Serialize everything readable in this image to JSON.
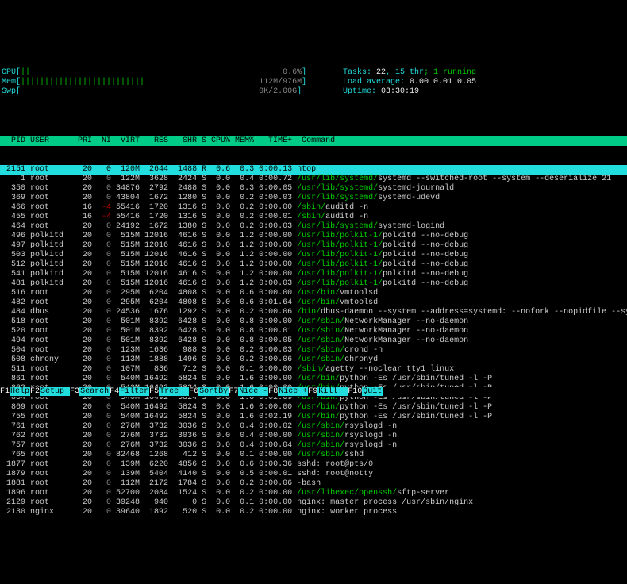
{
  "meters": {
    "cpu": {
      "label": "CPU",
      "bar": "||",
      "value": "0.6%"
    },
    "mem": {
      "label": "Mem",
      "bar": "||||||||||||||||||||||||||",
      "value": "112M/976M"
    },
    "swp": {
      "label": "Swp",
      "bar": "",
      "value": "0K/2.00G"
    }
  },
  "stats": {
    "tasks_label": "Tasks: ",
    "tasks": "22",
    "thr": ", 15 thr",
    "running": "; 1 running",
    "load_label": "Load average: ",
    "load": "0.00 0.01 0.05",
    "uptime_label": "Uptime: ",
    "uptime": "03:30:19"
  },
  "columns": "  PID USER      PRI  NI  VIRT   RES   SHR S CPU% MEM%   TIME+  Command",
  "rows": [
    {
      "sel": true,
      "pid": "2151",
      "user": "root",
      "pri": "20",
      "ni": "0",
      "virt": "120M",
      "res": "2644",
      "shr": "1488",
      "s": "R",
      "cpu": "0.6",
      "mem": "0.3",
      "time": "0:00.13",
      "cmd": "htop",
      "path": ""
    },
    {
      "pid": "1",
      "user": "root",
      "pri": "20",
      "ni": "0",
      "virt": "122M",
      "res": "3628",
      "shr": "2424",
      "s": "S",
      "cpu": "0.0",
      "mem": "0.4",
      "time": "0:00.72",
      "path": "/usr/lib/systemd/",
      "cmd": "systemd --switched-root --system --deserialize 21"
    },
    {
      "pid": "350",
      "user": "root",
      "pri": "20",
      "ni": "0",
      "virt": "34876",
      "res": "2792",
      "shr": "2488",
      "s": "S",
      "cpu": "0.0",
      "mem": "0.3",
      "time": "0:00.05",
      "path": "/usr/lib/systemd/",
      "cmd": "systemd-journald"
    },
    {
      "pid": "369",
      "user": "root",
      "pri": "20",
      "ni": "0",
      "virt": "43804",
      "res": "1672",
      "shr": "1280",
      "s": "S",
      "cpu": "0.0",
      "mem": "0.2",
      "time": "0:00.03",
      "path": "/usr/lib/systemd/",
      "cmd": "systemd-udevd"
    },
    {
      "pid": "466",
      "user": "root",
      "pri": "16",
      "ni": "-4",
      "virt": "55416",
      "res": "1720",
      "shr": "1316",
      "s": "S",
      "cpu": "0.0",
      "mem": "0.2",
      "time": "0:00.00",
      "path": "/sbin/",
      "cmd": "auditd -n"
    },
    {
      "pid": "455",
      "user": "root",
      "pri": "16",
      "ni": "-4",
      "virt": "55416",
      "res": "1720",
      "shr": "1316",
      "s": "S",
      "cpu": "0.0",
      "mem": "0.2",
      "time": "0:00.01",
      "path": "/sbin/",
      "cmd": "auditd -n"
    },
    {
      "pid": "464",
      "user": "root",
      "pri": "20",
      "ni": "0",
      "virt": "24192",
      "res": "1672",
      "shr": "1380",
      "s": "S",
      "cpu": "0.0",
      "mem": "0.2",
      "time": "0:00.03",
      "path": "/usr/lib/systemd/",
      "cmd": "systemd-logind"
    },
    {
      "pid": "496",
      "user": "polkitd",
      "pri": "20",
      "ni": "0",
      "virt": "515M",
      "res": "12016",
      "shr": "4616",
      "s": "S",
      "cpu": "0.0",
      "mem": "1.2",
      "time": "0:00.00",
      "path": "/usr/lib/polkit-1/",
      "cmd": "polkitd --no-debug"
    },
    {
      "pid": "497",
      "user": "polkitd",
      "pri": "20",
      "ni": "0",
      "virt": "515M",
      "res": "12016",
      "shr": "4616",
      "s": "S",
      "cpu": "0.0",
      "mem": "1.2",
      "time": "0:00.00",
      "path": "/usr/lib/polkit-1/",
      "cmd": "polkitd --no-debug"
    },
    {
      "pid": "503",
      "user": "polkitd",
      "pri": "20",
      "ni": "0",
      "virt": "515M",
      "res": "12016",
      "shr": "4616",
      "s": "S",
      "cpu": "0.0",
      "mem": "1.2",
      "time": "0:00.00",
      "path": "/usr/lib/polkit-1/",
      "cmd": "polkitd --no-debug"
    },
    {
      "pid": "512",
      "user": "polkitd",
      "pri": "20",
      "ni": "0",
      "virt": "515M",
      "res": "12016",
      "shr": "4616",
      "s": "S",
      "cpu": "0.0",
      "mem": "1.2",
      "time": "0:00.00",
      "path": "/usr/lib/polkit-1/",
      "cmd": "polkitd --no-debug"
    },
    {
      "pid": "541",
      "user": "polkitd",
      "pri": "20",
      "ni": "0",
      "virt": "515M",
      "res": "12016",
      "shr": "4616",
      "s": "S",
      "cpu": "0.0",
      "mem": "1.2",
      "time": "0:00.00",
      "path": "/usr/lib/polkit-1/",
      "cmd": "polkitd --no-debug"
    },
    {
      "pid": "481",
      "user": "polkitd",
      "pri": "20",
      "ni": "0",
      "virt": "515M",
      "res": "12016",
      "shr": "4616",
      "s": "S",
      "cpu": "0.0",
      "mem": "1.2",
      "time": "0:00.03",
      "path": "/usr/lib/polkit-1/",
      "cmd": "polkitd --no-debug"
    },
    {
      "pid": "516",
      "user": "root",
      "pri": "20",
      "ni": "0",
      "virt": "295M",
      "res": "6204",
      "shr": "4808",
      "s": "S",
      "cpu": "0.0",
      "mem": "0.6",
      "time": "0:00.00",
      "path": "/usr/bin/",
      "cmd": "vmtoolsd"
    },
    {
      "pid": "482",
      "user": "root",
      "pri": "20",
      "ni": "0",
      "virt": "295M",
      "res": "6204",
      "shr": "4808",
      "s": "S",
      "cpu": "0.0",
      "mem": "0.6",
      "time": "0:01.64",
      "path": "/usr/bin/",
      "cmd": "vmtoolsd"
    },
    {
      "pid": "484",
      "user": "dbus",
      "pri": "20",
      "ni": "0",
      "virt": "24536",
      "res": "1676",
      "shr": "1292",
      "s": "S",
      "cpu": "0.0",
      "mem": "0.2",
      "time": "0:00.06",
      "path": "/bin/",
      "cmd": "dbus-daemon --system --address=systemd: --nofork --nopidfile --systemd-activation"
    },
    {
      "pid": "518",
      "user": "root",
      "pri": "20",
      "ni": "0",
      "virt": "501M",
      "res": "8392",
      "shr": "6428",
      "s": "S",
      "cpu": "0.0",
      "mem": "0.8",
      "time": "0:00.00",
      "path": "/usr/sbin/",
      "cmd": "NetworkManager --no-daemon"
    },
    {
      "pid": "520",
      "user": "root",
      "pri": "20",
      "ni": "0",
      "virt": "501M",
      "res": "8392",
      "shr": "6428",
      "s": "S",
      "cpu": "0.0",
      "mem": "0.8",
      "time": "0:00.01",
      "path": "/usr/sbin/",
      "cmd": "NetworkManager --no-daemon"
    },
    {
      "pid": "494",
      "user": "root",
      "pri": "20",
      "ni": "0",
      "virt": "501M",
      "res": "8392",
      "shr": "6428",
      "s": "S",
      "cpu": "0.0",
      "mem": "0.8",
      "time": "0:00.05",
      "path": "/usr/sbin/",
      "cmd": "NetworkManager --no-daemon"
    },
    {
      "pid": "504",
      "user": "root",
      "pri": "20",
      "ni": "0",
      "virt": "123M",
      "res": "1636",
      "shr": "988",
      "s": "S",
      "cpu": "0.0",
      "mem": "0.2",
      "time": "0:00.03",
      "path": "/usr/sbin/",
      "cmd": "crond -n"
    },
    {
      "pid": "508",
      "user": "chrony",
      "pri": "20",
      "ni": "0",
      "virt": "113M",
      "res": "1888",
      "shr": "1496",
      "s": "S",
      "cpu": "0.0",
      "mem": "0.2",
      "time": "0:00.06",
      "path": "/usr/sbin/",
      "cmd": "chronyd"
    },
    {
      "pid": "511",
      "user": "root",
      "pri": "20",
      "ni": "0",
      "virt": "107M",
      "res": "836",
      "shr": "712",
      "s": "S",
      "cpu": "0.0",
      "mem": "0.1",
      "time": "0:00.00",
      "path": "/sbin/",
      "cmd": "agetty --noclear tty1 linux"
    },
    {
      "pid": "861",
      "user": "root",
      "pri": "20",
      "ni": "0",
      "virt": "540M",
      "res": "16492",
      "shr": "5824",
      "s": "S",
      "cpu": "0.0",
      "mem": "1.6",
      "time": "0:00.00",
      "path": "/usr/bin/",
      "cmd": "python -Es /usr/sbin/tuned -l -P"
    },
    {
      "pid": "862",
      "user": "root",
      "pri": "20",
      "ni": "0",
      "virt": "540M",
      "res": "16492",
      "shr": "5824",
      "s": "S",
      "cpu": "0.0",
      "mem": "1.6",
      "time": "0:00.00",
      "path": "/usr/bin/",
      "cmd": "python -Es /usr/sbin/tuned -l -P"
    },
    {
      "pid": "864",
      "user": "root",
      "pri": "20",
      "ni": "0",
      "virt": "540M",
      "res": "16492",
      "shr": "5824",
      "s": "S",
      "cpu": "0.0",
      "mem": "1.6",
      "time": "0:02.09",
      "path": "/usr/bin/",
      "cmd": "python -Es /usr/sbin/tuned -l -P"
    },
    {
      "pid": "869",
      "user": "root",
      "pri": "20",
      "ni": "0",
      "virt": "540M",
      "res": "16492",
      "shr": "5824",
      "s": "S",
      "cpu": "0.0",
      "mem": "1.6",
      "time": "0:00.00",
      "path": "/usr/bin/",
      "cmd": "python -Es /usr/sbin/tuned -l -P"
    },
    {
      "pid": "755",
      "user": "root",
      "pri": "20",
      "ni": "0",
      "virt": "540M",
      "res": "16492",
      "shr": "5824",
      "s": "S",
      "cpu": "0.0",
      "mem": "1.6",
      "time": "0:02.19",
      "path": "/usr/bin/",
      "cmd": "python -Es /usr/sbin/tuned -l -P"
    },
    {
      "pid": "761",
      "user": "root",
      "pri": "20",
      "ni": "0",
      "virt": "276M",
      "res": "3732",
      "shr": "3036",
      "s": "S",
      "cpu": "0.0",
      "mem": "0.4",
      "time": "0:00.02",
      "path": "/usr/sbin/",
      "cmd": "rsyslogd -n"
    },
    {
      "pid": "762",
      "user": "root",
      "pri": "20",
      "ni": "0",
      "virt": "276M",
      "res": "3732",
      "shr": "3036",
      "s": "S",
      "cpu": "0.0",
      "mem": "0.4",
      "time": "0:00.00",
      "path": "/usr/sbin/",
      "cmd": "rsyslogd -n"
    },
    {
      "pid": "757",
      "user": "root",
      "pri": "20",
      "ni": "0",
      "virt": "276M",
      "res": "3732",
      "shr": "3036",
      "s": "S",
      "cpu": "0.0",
      "mem": "0.4",
      "time": "0:00.04",
      "path": "/usr/sbin/",
      "cmd": "rsyslogd -n"
    },
    {
      "pid": "765",
      "user": "root",
      "pri": "20",
      "ni": "0",
      "virt": "82468",
      "res": "1268",
      "shr": "412",
      "s": "S",
      "cpu": "0.0",
      "mem": "0.1",
      "time": "0:00.00",
      "path": "/usr/sbin/",
      "cmd": "sshd"
    },
    {
      "pid": "1877",
      "user": "root",
      "pri": "20",
      "ni": "0",
      "virt": "139M",
      "res": "6220",
      "shr": "4856",
      "s": "S",
      "cpu": "0.0",
      "mem": "0.6",
      "time": "0:00.36",
      "path": "",
      "cmd": "sshd: root@pts/0"
    },
    {
      "pid": "1879",
      "user": "root",
      "pri": "20",
      "ni": "0",
      "virt": "139M",
      "res": "5404",
      "shr": "4140",
      "s": "S",
      "cpu": "0.0",
      "mem": "0.5",
      "time": "0:00.01",
      "path": "",
      "cmd": "sshd: root@notty"
    },
    {
      "pid": "1881",
      "user": "root",
      "pri": "20",
      "ni": "0",
      "virt": "112M",
      "res": "2172",
      "shr": "1784",
      "s": "S",
      "cpu": "0.0",
      "mem": "0.2",
      "time": "0:00.06",
      "path": "",
      "cmd": "-bash"
    },
    {
      "pid": "1896",
      "user": "root",
      "pri": "20",
      "ni": "0",
      "virt": "52700",
      "res": "2084",
      "shr": "1524",
      "s": "S",
      "cpu": "0.0",
      "mem": "0.2",
      "time": "0:00.00",
      "path": "/usr/libexec/openssh/",
      "cmd": "sftp-server"
    },
    {
      "pid": "2129",
      "user": "root",
      "pri": "20",
      "ni": "0",
      "virt": "39248",
      "res": "940",
      "shr": "0",
      "s": "S",
      "cpu": "0.0",
      "mem": "0.1",
      "time": "0:00.00",
      "path": "",
      "cmd": "nginx: master process /usr/sbin/nginx"
    },
    {
      "pid": "2130",
      "user": "nginx",
      "pri": "20",
      "ni": "0",
      "virt": "39640",
      "res": "1892",
      "shr": "520",
      "s": "S",
      "cpu": "0.0",
      "mem": "0.2",
      "time": "0:00.00",
      "path": "",
      "cmd": "nginx: worker process"
    }
  ],
  "footer": [
    {
      "k": "F1",
      "l": "Help"
    },
    {
      "k": "F2",
      "l": "Setup "
    },
    {
      "k": "F3",
      "l": "Search"
    },
    {
      "k": "F4",
      "l": "Filter"
    },
    {
      "k": "F5",
      "l": "Tree  "
    },
    {
      "k": "F6",
      "l": "SortBy"
    },
    {
      "k": "F7",
      "l": "Nice -"
    },
    {
      "k": "F8",
      "l": "Nice +"
    },
    {
      "k": "F9",
      "l": "Kill  "
    },
    {
      "k": "F10",
      "l": "Quit"
    }
  ]
}
